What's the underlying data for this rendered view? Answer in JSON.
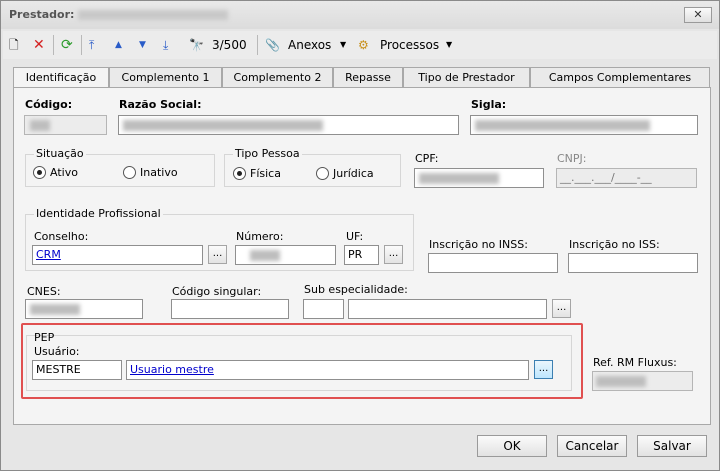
{
  "window": {
    "title": "Prestador:",
    "close": "✕"
  },
  "toolbar": {
    "record_counter": "3/500",
    "anexos": "Anexos",
    "processos": "Processos"
  },
  "tabs": [
    "Identificação",
    "Complemento 1",
    "Complemento 2",
    "Repasse",
    "Tipo de Prestador",
    "Campos Complementares"
  ],
  "form": {
    "codigo_label": "Código:",
    "razao_label": "Razão Social:",
    "sigla_label": "Sigla:",
    "situacao": {
      "title": "Situação",
      "ativo": "Ativo",
      "inativo": "Inativo",
      "selected": "Ativo"
    },
    "tipo_pessoa": {
      "title": "Tipo Pessoa",
      "fisica": "Física",
      "juridica": "Jurídica",
      "selected": "Física"
    },
    "cpf_label": "CPF:",
    "cnpj_label": "CNPJ:",
    "cnpj_mask": "__.___.___/____-__",
    "identidade": {
      "title": "Identidade Profissional",
      "conselho_label": "Conselho:",
      "conselho_value": "CRM",
      "numero_label": "Número:",
      "uf_label": "UF:",
      "uf_value": "PR"
    },
    "inss_label": "Inscrição no INSS:",
    "iss_label": "Inscrição no ISS:",
    "cnes_label": "CNES:",
    "codigo_singular_label": "Código singular:",
    "sub_especialidade_label": "Sub especialidade:",
    "pep": {
      "title": "PEP",
      "usuario_label": "Usuário:",
      "usuario_code": "MESTRE",
      "usuario_name": "Usuario mestre"
    },
    "ref_rm_label": "Ref. RM Fluxus:",
    "dots": "..."
  },
  "buttons": {
    "ok": "OK",
    "cancel": "Cancelar",
    "save": "Salvar"
  }
}
